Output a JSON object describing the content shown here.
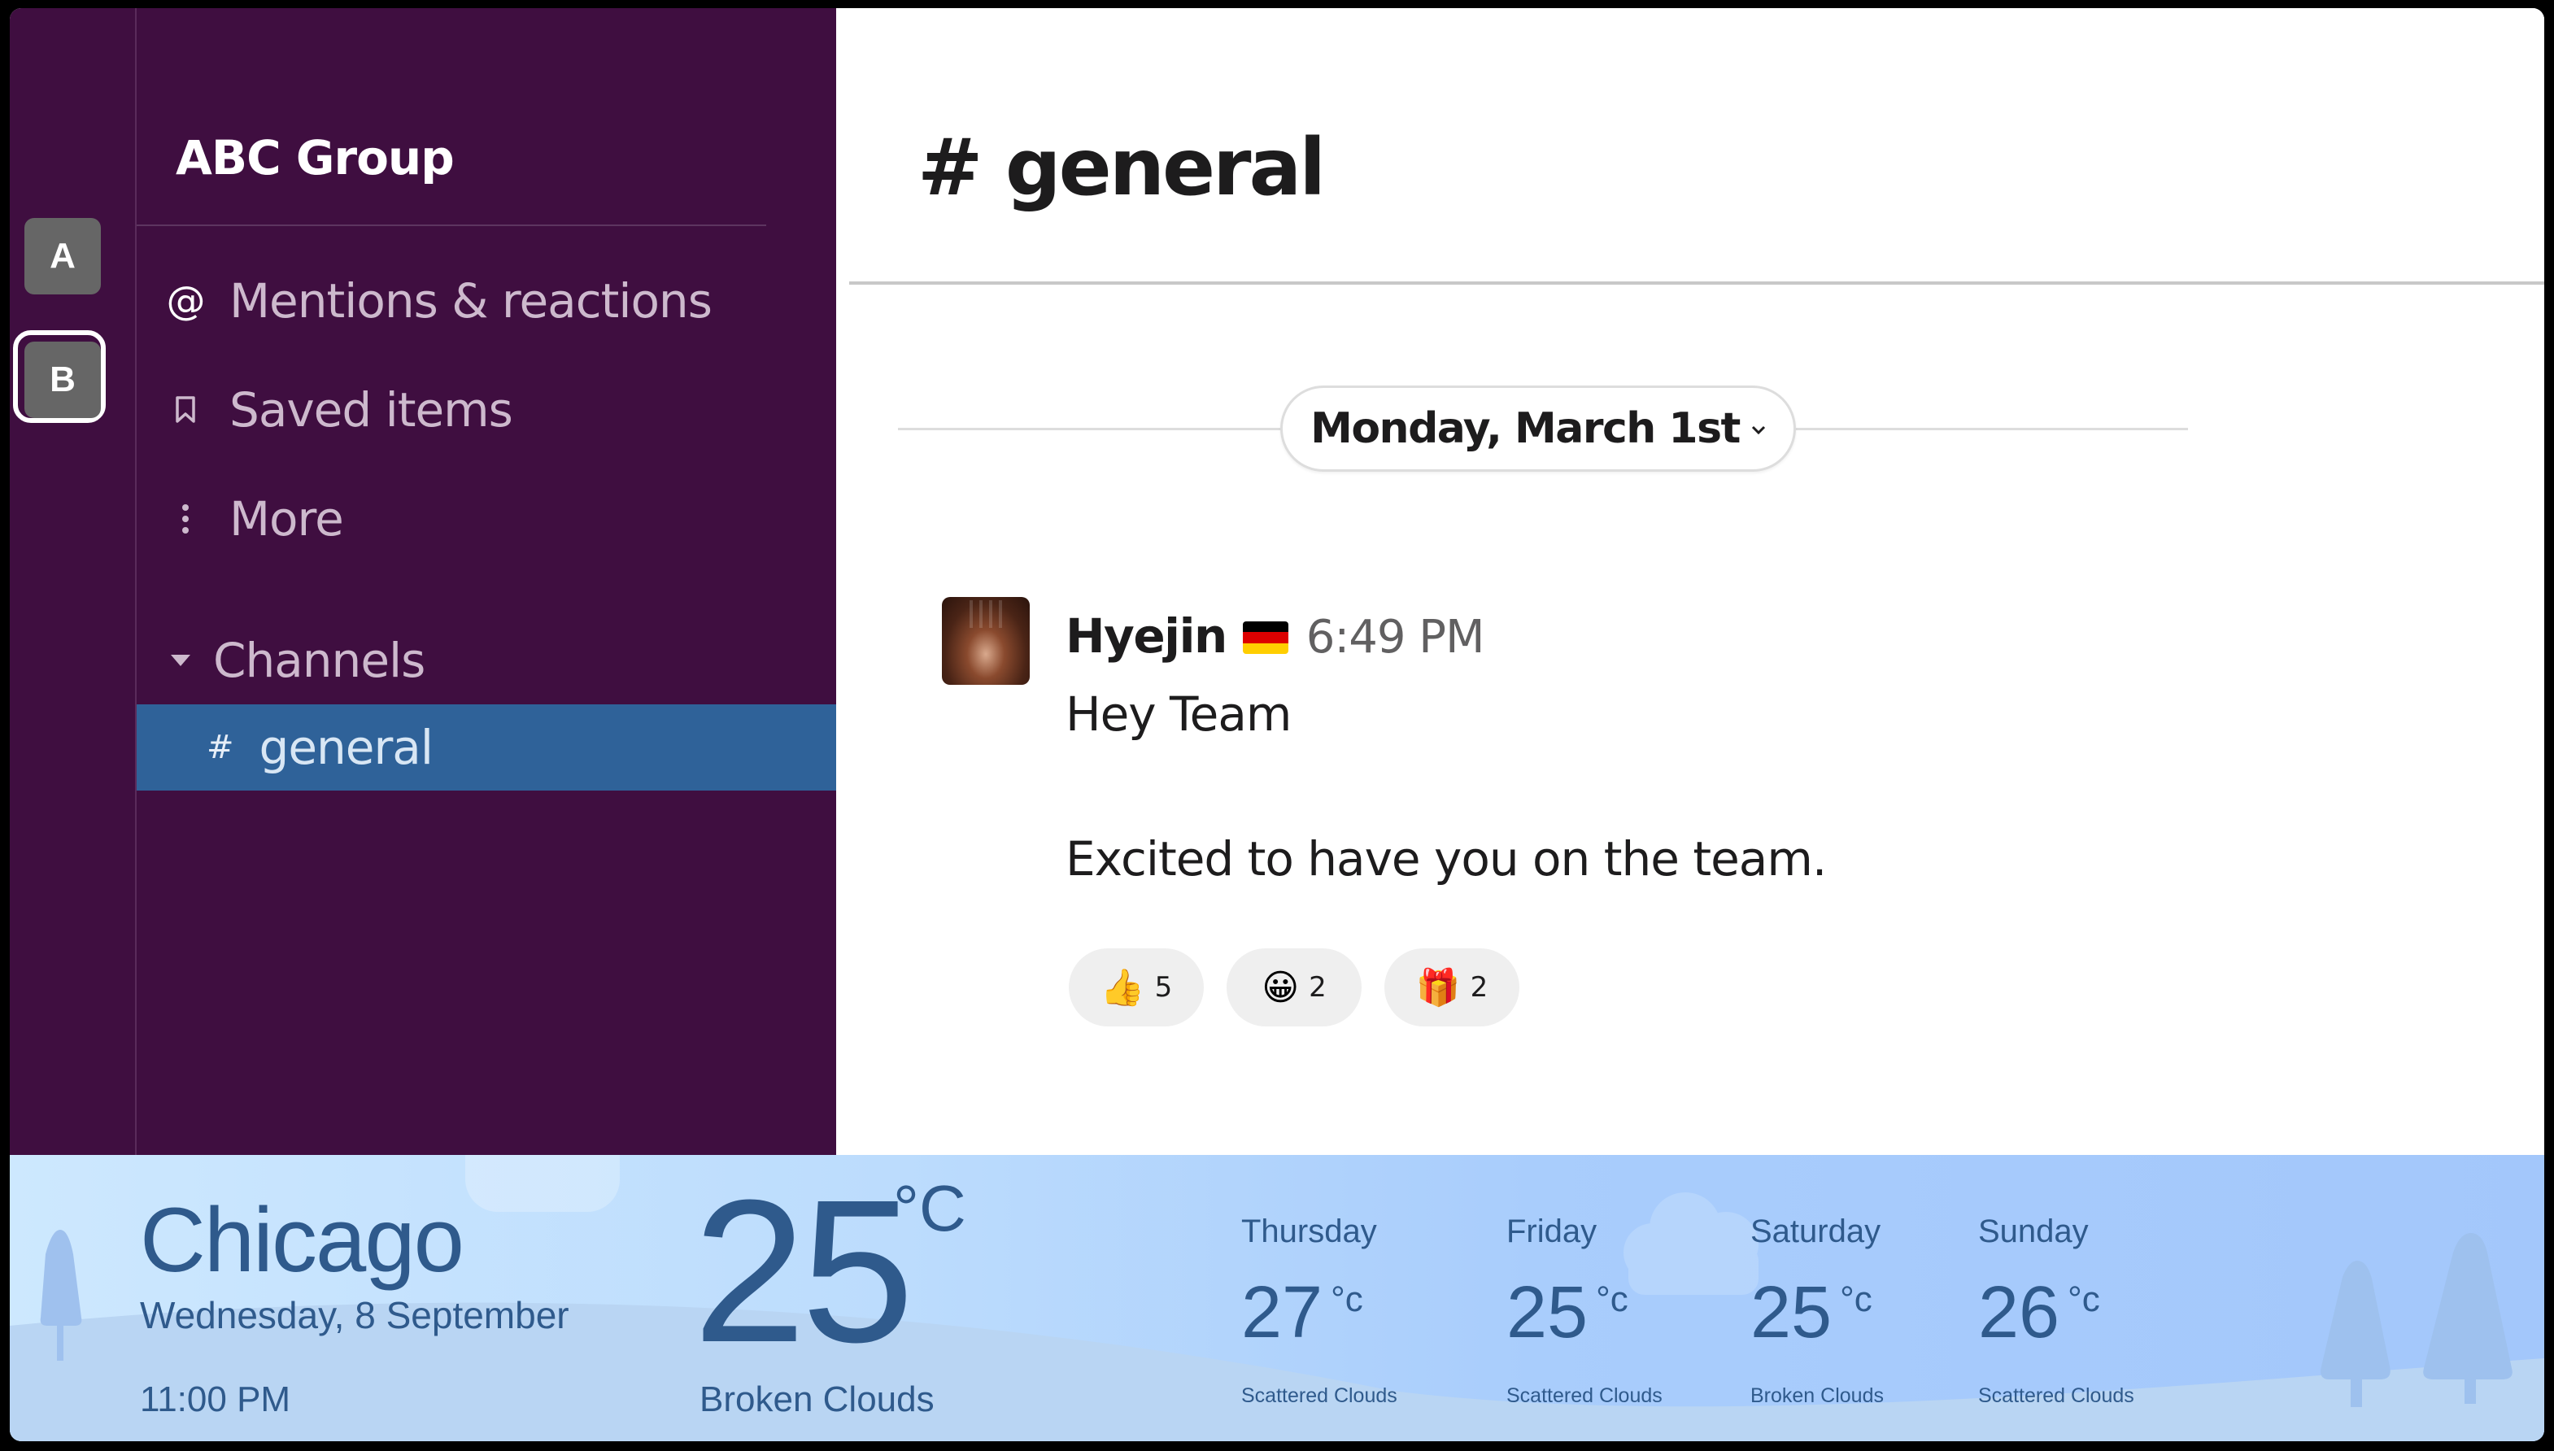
{
  "workspaces": [
    {
      "letter": "A",
      "selected": false
    },
    {
      "letter": "B",
      "selected": true
    }
  ],
  "sidebar": {
    "team_name": "ABC Group",
    "nav": [
      {
        "icon": "at-icon",
        "glyph": "@",
        "label": "Mentions & reactions"
      },
      {
        "icon": "bookmark-icon",
        "glyph": "🔖",
        "label": "Saved items"
      },
      {
        "icon": "more-vertical-icon",
        "glyph": "⋮",
        "label": "More"
      }
    ],
    "channels_header": "Channels",
    "channels": [
      {
        "hash": "#",
        "name": "general",
        "active": true
      }
    ]
  },
  "main": {
    "channel_title": "# general",
    "date_divider": "Monday, March 1st",
    "date_chevron": "⌄",
    "message": {
      "author": "Hyejin",
      "status_emoji": "German flag",
      "time": "6:49 PM",
      "lines": [
        "Hey Team",
        "Excited to have you on the team."
      ],
      "reactions": [
        {
          "emoji": "👍",
          "name": "thumbs-up",
          "count": "5"
        },
        {
          "emoji": "😀",
          "name": "grinning-face",
          "count": "2"
        },
        {
          "emoji": "🎁",
          "name": "wrapped-gift",
          "count": "2"
        }
      ]
    }
  },
  "weather": {
    "city": "Chicago",
    "date": "Wednesday, 8 September",
    "time": "11:00 PM",
    "temp": "25",
    "unit": "°C",
    "condition": "Broken Clouds",
    "forecast": [
      {
        "day": "Thursday",
        "temp": "27",
        "unit": "°c",
        "desc": "Scattered Clouds"
      },
      {
        "day": "Friday",
        "temp": "25",
        "unit": "°c",
        "desc": "Scattered Clouds"
      },
      {
        "day": "Saturday",
        "temp": "25",
        "unit": "°c",
        "desc": "Broken Clouds"
      },
      {
        "day": "Sunday",
        "temp": "26",
        "unit": "°c",
        "desc": "Scattered Clouds"
      }
    ]
  },
  "colors": {
    "sidebar_bg": "#3F0E40",
    "active_channel_bg": "#2F6299",
    "weather_text": "#2F5A8C",
    "flag": [
      "#000000",
      "#DD0000",
      "#FFCE00"
    ]
  }
}
